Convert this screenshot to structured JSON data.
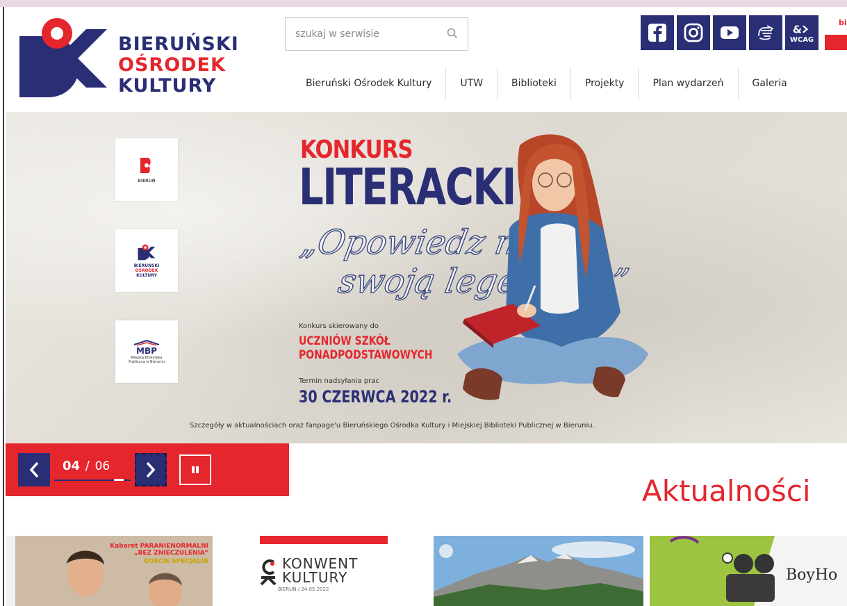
{
  "logo": {
    "line1": "BIERUŃSKI",
    "line2": "OŚRODEK",
    "line3": "KULTURY"
  },
  "search": {
    "placeholder": "szukaj w serwisie"
  },
  "social": {
    "wcag_label": "WCAG",
    "bip_label": "bi"
  },
  "nav": {
    "items": [
      "Bieruński Ośrodek Kultury",
      "UTW",
      "Biblioteki",
      "Projekty",
      "Plan wydarzeń",
      "Galeria"
    ]
  },
  "banner": {
    "cards": {
      "bierun": "BIERUŃ",
      "bok_l1": "BIERUŃSKI",
      "bok_l2": "OŚRODEK",
      "bok_l3": "KULTURY",
      "mbp": "MBP",
      "mbp_sub": "Miejska Biblioteka Publiczna w Bieruniu"
    },
    "title1": "KONKURS",
    "title2": "LITERACKI",
    "script1": "„Opowiedz mi",
    "script2": "swoją legendę...”",
    "target_intro": "Konkurs skierowany do",
    "target_l1": "UCZNIÓW SZKÓŁ",
    "target_l2": "PONADPODSTAWOWYCH",
    "deadline_intro": "Termin nadsyłania prac",
    "deadline": "30 CZERWCA 2022 r.",
    "footer": "Szczegóły w aktualnościach oraz fanpage'u Bieruńskiego Ośrodka Kultury i Miejskiej Biblioteki Publicznej w Bieruniu."
  },
  "slider": {
    "current": "04",
    "separator": "/",
    "total": "06",
    "progress": 0.667
  },
  "section": {
    "news_heading": "Aktualności"
  },
  "news": {
    "item1_title": "Kabaret PARANIENORMALNI „BEZ ZNIECZULENIA”",
    "item1_sub": "GOŚCIE SPECJALNI",
    "item2_l1": "KONWENT",
    "item2_l2": "KULTURY",
    "item2_sub": "BIERUŃ / 24.05.2022",
    "item4_title": "BoyHo"
  },
  "colors": {
    "navy": "#2a2e75",
    "red": "#e5262d"
  }
}
